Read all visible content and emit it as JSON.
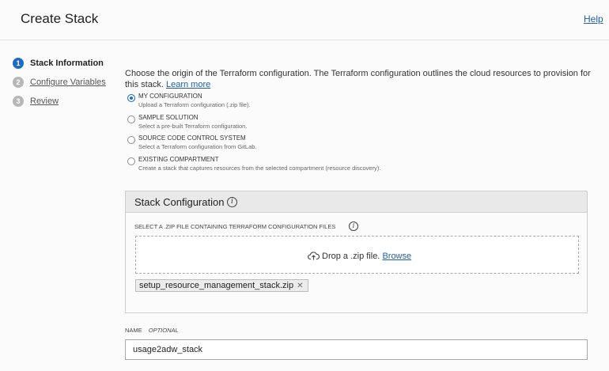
{
  "header": {
    "title": "Create Stack",
    "help_label": "Help"
  },
  "steps": [
    {
      "num": "1",
      "label": "Stack Information",
      "active": true
    },
    {
      "num": "2",
      "label": "Configure Variables",
      "active": false
    },
    {
      "num": "3",
      "label": "Review",
      "active": false
    }
  ],
  "intro": {
    "text": "Choose the origin of the Terraform configuration. The Terraform configuration outlines the cloud resources to provision for this stack.",
    "learn_more": "Learn more"
  },
  "origin_options": [
    {
      "title": "MY CONFIGURATION",
      "desc": "Upload a Terraform configuration (.zip file).",
      "selected": true
    },
    {
      "title": "SAMPLE SOLUTION",
      "desc": "Select a pre-built Terraform configuration.",
      "selected": false
    },
    {
      "title": "SOURCE CODE CONTROL SYSTEM",
      "desc": "Select a Terraform configuration from GitLab.",
      "selected": false
    },
    {
      "title": "EXISTING COMPARTMENT",
      "desc": "Create a stack that captures resources from the selected compartment (resource discovery).",
      "selected": false
    }
  ],
  "stack_config": {
    "title": "Stack Configuration",
    "zip_label": "SELECT A .ZIP FILE CONTAINING TERRAFORM CONFIGURATION FILES",
    "drop_text": "Drop a .zip file.",
    "browse_label": "Browse",
    "file_chip": "setup_resource_management_stack.zip",
    "chip_remove": "✕"
  },
  "name_field": {
    "label": "NAME",
    "optional": "OPTIONAL",
    "value": "usage2adw_stack"
  },
  "icons": {
    "info": "info-icon",
    "upload": "cloud-upload-icon",
    "remove": "close-icon"
  },
  "colors": {
    "accent": "#1e6bc6",
    "link": "#1f5fa8"
  }
}
